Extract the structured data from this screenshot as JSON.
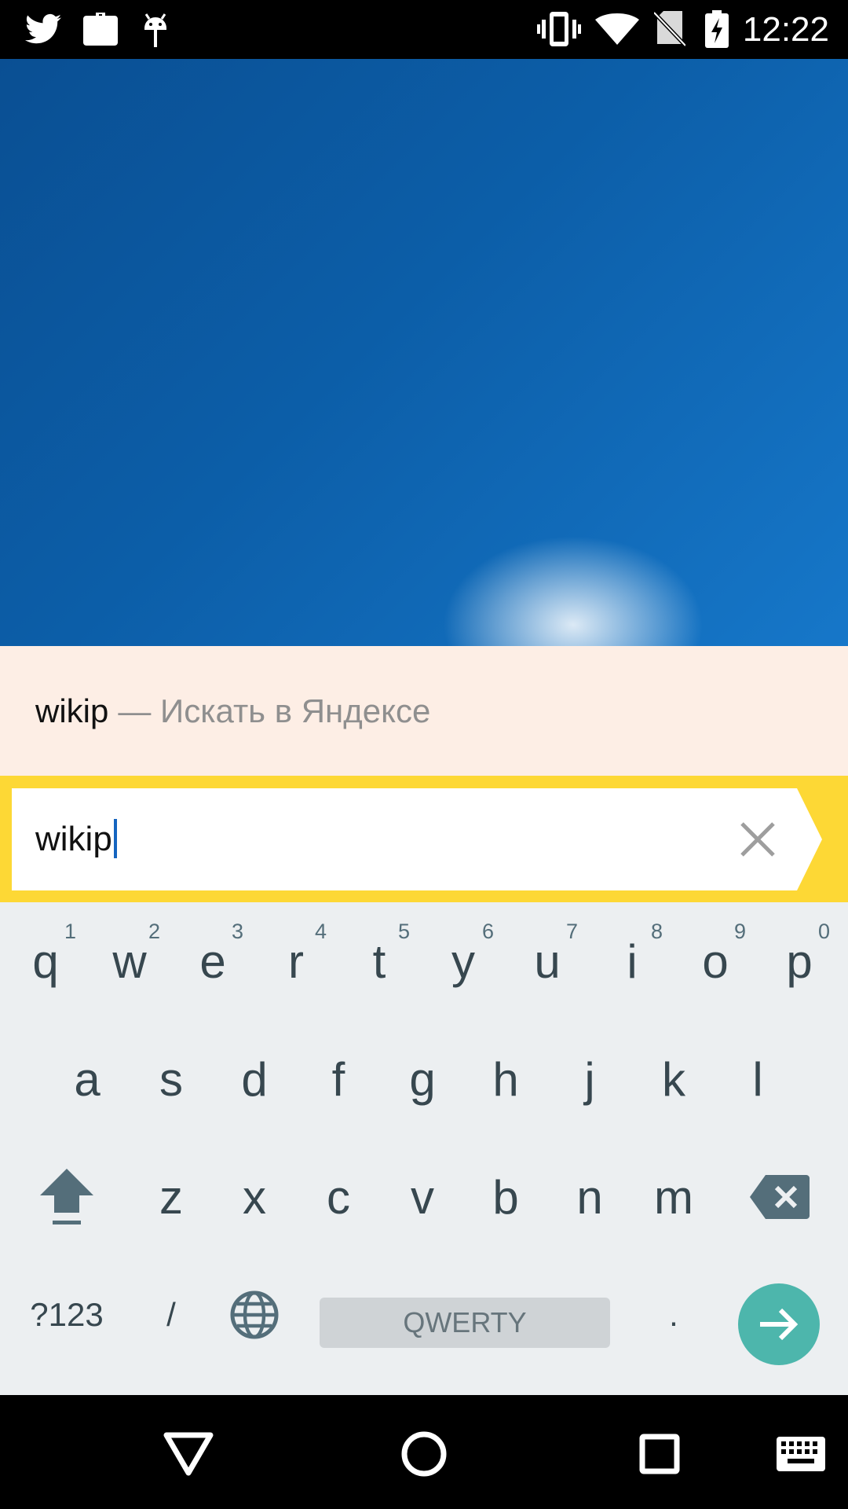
{
  "status_bar": {
    "time": "12:22",
    "left_icons": [
      "twitter-icon",
      "briefcase-check-icon",
      "android-debug-icon"
    ],
    "right_icons": [
      "vibrate-icon",
      "wifi-icon",
      "no-sim-icon",
      "battery-charging-icon"
    ]
  },
  "suggestion": {
    "query": "wikip",
    "hint": "— Искать в Яндексе"
  },
  "search": {
    "value": "wikip",
    "accent_color": "#fdd835"
  },
  "keyboard": {
    "row1": [
      {
        "key": "q",
        "hint": "1"
      },
      {
        "key": "w",
        "hint": "2"
      },
      {
        "key": "e",
        "hint": "3"
      },
      {
        "key": "r",
        "hint": "4"
      },
      {
        "key": "t",
        "hint": "5"
      },
      {
        "key": "y",
        "hint": "6"
      },
      {
        "key": "u",
        "hint": "7"
      },
      {
        "key": "i",
        "hint": "8"
      },
      {
        "key": "o",
        "hint": "9"
      },
      {
        "key": "p",
        "hint": "0"
      }
    ],
    "row2": [
      "a",
      "s",
      "d",
      "f",
      "g",
      "h",
      "j",
      "k",
      "l"
    ],
    "row3": [
      "z",
      "x",
      "c",
      "v",
      "b",
      "n",
      "m"
    ],
    "symbols_label": "?123",
    "slash_label": "/",
    "space_label": "QWERTY",
    "period_label": ".",
    "enter_color": "#4db6ac"
  },
  "nav_bar": {
    "buttons": [
      "back-icon",
      "home-icon",
      "recents-icon",
      "keyboard-icon"
    ]
  }
}
